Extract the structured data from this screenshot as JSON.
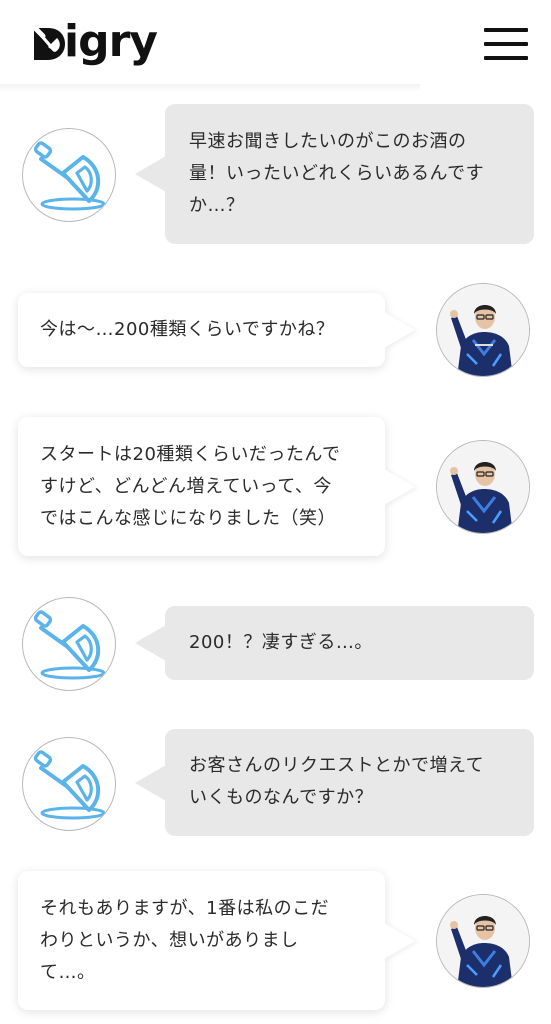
{
  "header": {
    "logo_text": "igry",
    "menu_icon": "hamburger-menu-icon"
  },
  "colors": {
    "brand_blue": "#5ab4ea",
    "left_bubble": "#e8e8e8",
    "right_bubble": "#ffffff"
  },
  "messages": [
    {
      "speaker": "interviewer",
      "text": "早速お聞きしたいのがこのお酒の\n量！いったいどれくらいあるんです\nか…？"
    },
    {
      "speaker": "owner",
      "text": "今は〜…200種類くらいですかね？"
    },
    {
      "speaker": "owner",
      "text": "スタートは20種類くらいだったんで\nすけど、どんどん増えていって、今\nではこんな感じになりました（笑）"
    },
    {
      "speaker": "interviewer",
      "text": "200！？凄すぎる…。"
    },
    {
      "speaker": "interviewer",
      "text": "お客さんのリクエストとかで増えて\nいくものなんですか？"
    },
    {
      "speaker": "owner",
      "text": "それもありますが、1番は私のこだ\nわりというか、想いがありまし\nて…。"
    }
  ]
}
